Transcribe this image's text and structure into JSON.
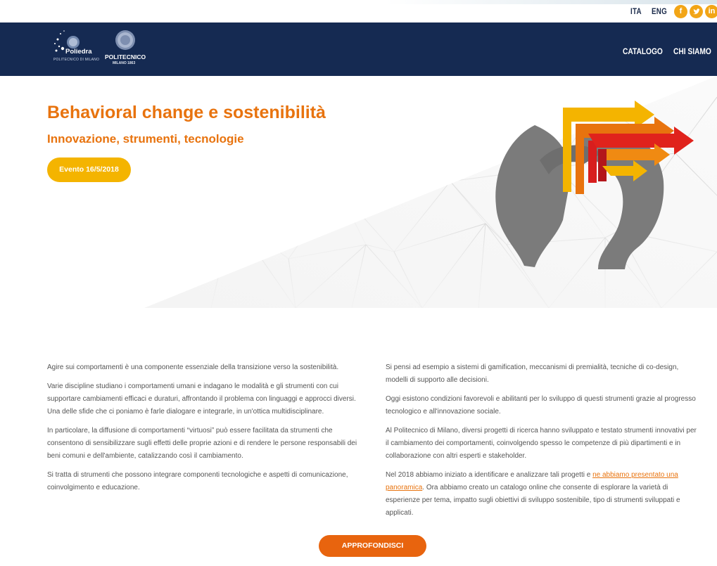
{
  "top": {
    "languages": [
      "ITA",
      "ENG"
    ],
    "social": [
      {
        "icon": "facebook-icon",
        "glyph": "f"
      },
      {
        "icon": "twitter-icon",
        "glyph": "t"
      },
      {
        "icon": "linkedin-icon",
        "glyph": "in"
      }
    ]
  },
  "header": {
    "logo_poliedra": {
      "name": "Poliedra",
      "sub": "POLITECNICO DI MILANO"
    },
    "logo_polimi": {
      "name": "POLITECNICO",
      "sub": "MILANO 1863"
    },
    "nav": [
      "CATALOGO",
      "CHI SIAMO"
    ]
  },
  "hero": {
    "title": "Behavioral change e sostenibilità",
    "subtitle": "Innovazione, strumenti, tecnologie",
    "badge": "Evento 16/5/2018"
  },
  "content": {
    "left": [
      "Agire sui comportamenti è una componente essenziale della transizione verso la sostenibilità.",
      "Varie discipline studiano i comportamenti umani e indagano le modalità e gli strumenti con cui supportare cambiamenti efficaci e duraturi, affrontando il problema con linguaggi e approcci diversi.  Una delle sfide che ci poniamo è farle dialogare e integrarle, in un'ottica multidisciplinare.",
      "In particolare, la diffusione di comportamenti “virtuosi” può essere facilitata da strumenti che consentono di sensibilizzare sugli effetti delle proprie azioni e di rendere le persone responsabili dei beni comuni e dell'ambiente, catalizzando così il cambiamento.",
      "Si tratta di strumenti che possono integrare componenti tecnologiche e aspetti di comunicazione, coinvolgimento e educazione."
    ],
    "right": [
      "Si pensi ad esempio a sistemi di gamification, meccanismi di premialità, tecniche di co-design, modelli di supporto alle decisioni.",
      "Oggi esistono condizioni favorevoli e abilitanti per lo sviluppo di questi strumenti grazie al progresso tecnologico e all'innovazione sociale.",
      "Al Politecnico di Milano, diversi progetti di ricerca hanno sviluppato e testato strumenti innovativi per il cambiamento dei comportamenti, coinvolgendo spesso le competenze di più dipartimenti e in collaborazione con altri esperti e stakeholder."
    ],
    "last_paragraph": {
      "before": "Nel 2018 abbiamo iniziato a identificare e analizzare tali progetti e ",
      "link": "ne abbiamo presentato una panoramica",
      "after": ". Ora abbiamo creato un catalogo online che consente di esplorare la varietà di esperienze per tema, impatto sugli obiettivi di sviluppo sostenibile, tipo di strumenti sviluppati e applicati."
    },
    "cta": "APPROFONDISCI"
  },
  "colors": {
    "navy": "#152a52",
    "orange": "#e8730e",
    "yellow": "#f4b400",
    "cta": "#e8640e"
  }
}
